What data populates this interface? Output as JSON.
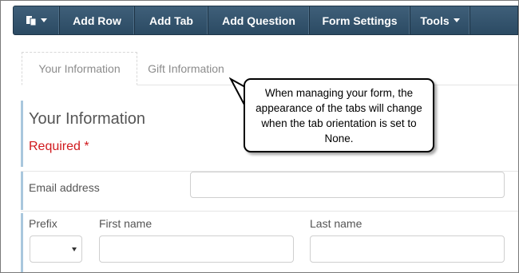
{
  "toolbar": {
    "page_icon": "page-layout-icon",
    "buttons": [
      {
        "label": "Add Row"
      },
      {
        "label": "Add Tab"
      },
      {
        "label": "Add Question"
      },
      {
        "label": "Form Settings"
      },
      {
        "label": "Tools"
      }
    ]
  },
  "tabs": [
    {
      "label": "Your Information",
      "active": true
    },
    {
      "label": "Gift Information",
      "active": false
    }
  ],
  "callout": {
    "text": "When managing your form, the appearance of the tabs will change when the tab orientation is set to None."
  },
  "section": {
    "title": "Your Information",
    "required": "Required *"
  },
  "fields": {
    "email_label": "Email address",
    "email_value": "",
    "prefix_label": "Prefix",
    "prefix_value": "",
    "first_name_label": "First name",
    "first_name_value": "",
    "last_name_label": "Last name",
    "last_name_value": ""
  },
  "colors": {
    "toolbar": "#34536d",
    "section_accent": "#a9c7dd",
    "required": "#d0191d"
  }
}
